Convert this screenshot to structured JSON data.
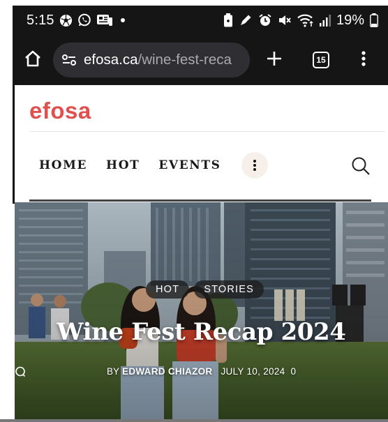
{
  "status_bar": {
    "time": "5:15",
    "battery": "19%",
    "icons": [
      "soccer-icon",
      "whatsapp-icon",
      "news-icon",
      "dot-icon",
      "battery-saver-icon",
      "pen-icon",
      "alarm-icon",
      "mute-icon",
      "wifi-icon",
      "signal-icon",
      "battery-icon"
    ]
  },
  "browser": {
    "url_host": "efosa.ca",
    "url_path": "/wine-fest-reca",
    "tab_count": "15",
    "icons": [
      "home-icon",
      "site-info-icon",
      "plus-icon",
      "tabs-icon",
      "more-vert-icon"
    ]
  },
  "site": {
    "logo": "efosa",
    "brand_color": "#e0504e",
    "nav": [
      "HOME",
      "HOT",
      "EVENTS"
    ],
    "icons": [
      "more-vert-icon",
      "search-icon"
    ]
  },
  "post": {
    "categories": [
      "HOT",
      "STORIES"
    ],
    "title": "Wine Fest Recap 2024",
    "by": "BY",
    "author": "EDWARD CHIAZOR",
    "date": "JULY 10, 2024",
    "comments": "0"
  }
}
